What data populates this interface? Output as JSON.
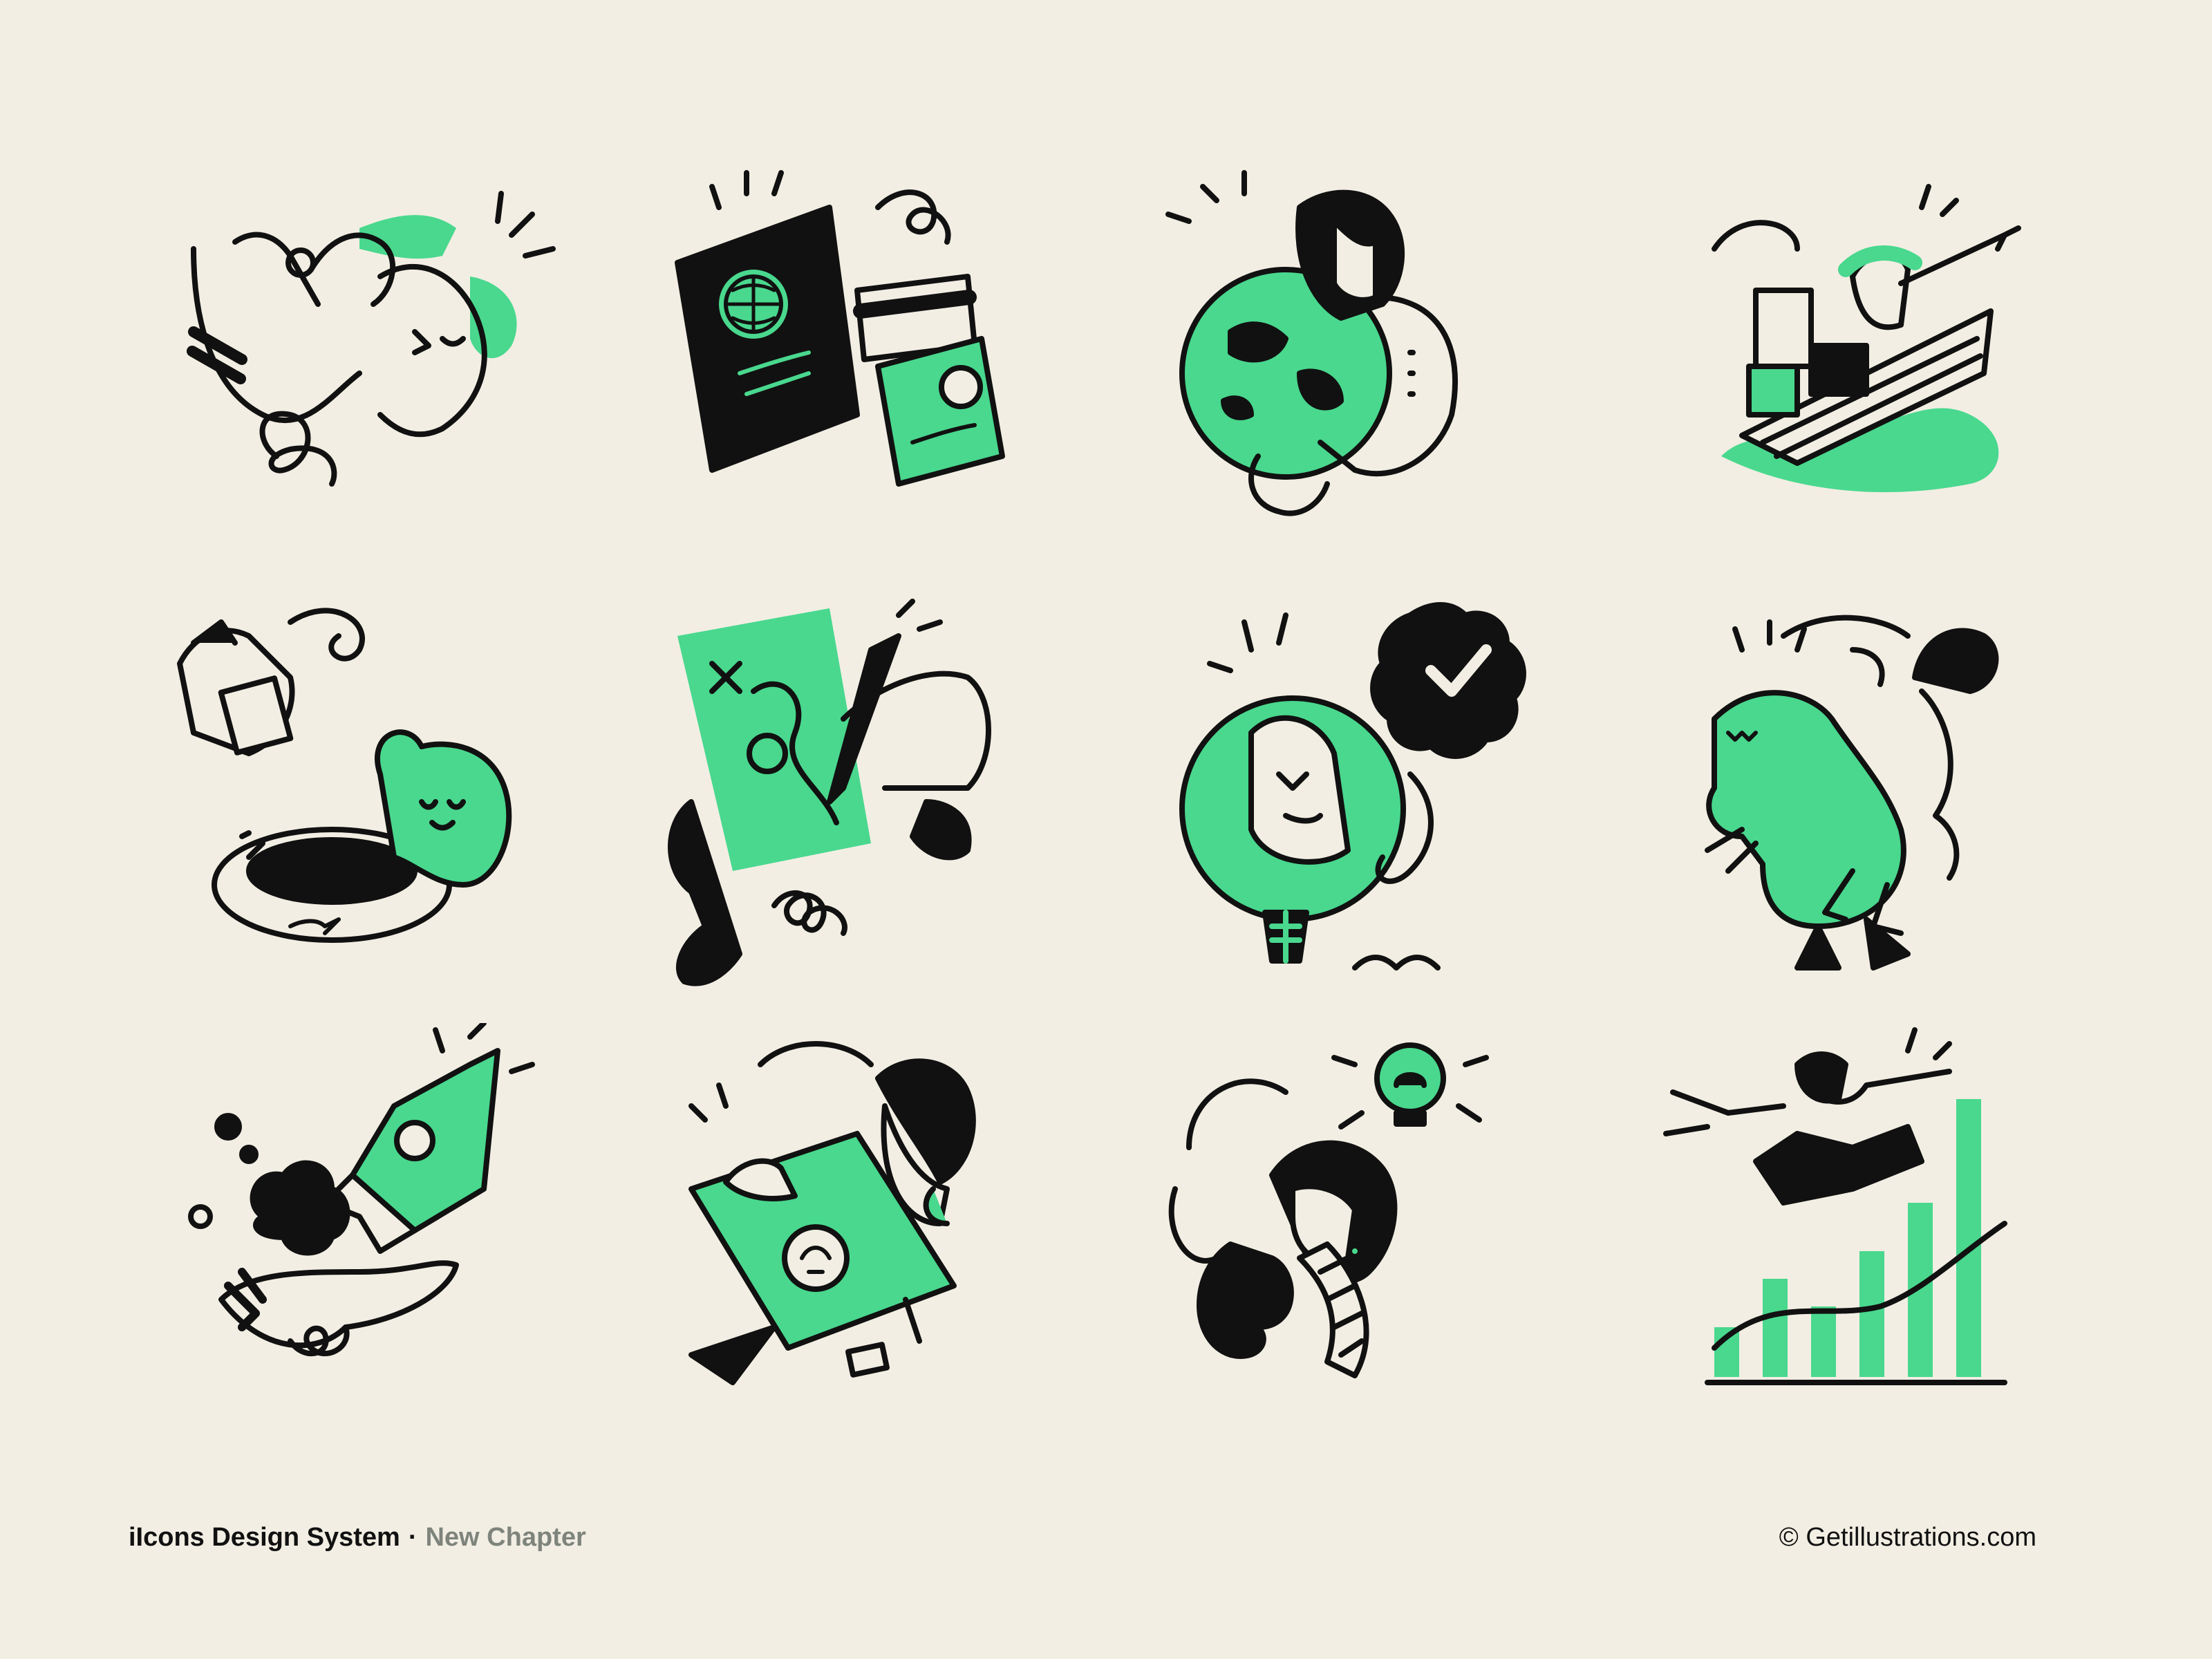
{
  "footer": {
    "brand": "iIcons Design System",
    "separator": "·",
    "chapter": "New Chapter",
    "credit": "© Getillustrations.com"
  },
  "colors": {
    "background": "#f2eee3",
    "accent_green": "#49d88e",
    "ink": "#111111",
    "chapter_gray": "#7e847c"
  },
  "illustrations": [
    {
      "icon": "hand-feeding-leaf-to-face-icon"
    },
    {
      "icon": "passport-and-documents-icon"
    },
    {
      "icon": "woman-hugging-globe-icon"
    },
    {
      "icon": "person-in-boat-with-boxes-icon"
    },
    {
      "icon": "hand-feeding-cat-icon"
    },
    {
      "icon": "hands-drawing-plan-icon"
    },
    {
      "icon": "verified-person-badge-icon"
    },
    {
      "icon": "dinosaur-with-person-icon"
    },
    {
      "icon": "rocket-launch-from-hand-icon"
    },
    {
      "icon": "woman-with-blueprint-icon"
    },
    {
      "icon": "woman-idea-bulb-icon"
    },
    {
      "icon": "person-leaping-over-bar-chart-icon"
    }
  ]
}
